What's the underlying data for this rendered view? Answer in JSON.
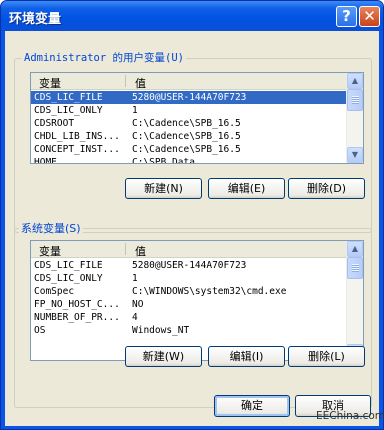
{
  "window": {
    "title": "环境变量",
    "help_label": "?",
    "close_label": "✕"
  },
  "user_vars": {
    "group_label": "Administrator 的用户变量(U)",
    "columns": [
      "变量",
      "值"
    ],
    "rows": [
      {
        "name": "CDS_LIC_FILE",
        "value": "5280@USER-144A70F723",
        "selected": true
      },
      {
        "name": "CDS_LIC_ONLY",
        "value": "1"
      },
      {
        "name": "CDSROOT",
        "value": "C:\\Cadence\\SPB_16.5"
      },
      {
        "name": "CHDL_LIB_INS...",
        "value": "C:\\Cadence\\SPB_16.5"
      },
      {
        "name": "CONCEPT_INST...",
        "value": "C:\\Cadence\\SPB_16.5"
      },
      {
        "name": "HOME",
        "value": "C:\\SPB_Data"
      }
    ],
    "buttons": {
      "new": "新建(N)",
      "edit": "编辑(E)",
      "delete": "删除(D)"
    }
  },
  "system_vars": {
    "group_label": "系统变量(S)",
    "columns": [
      "变量",
      "值"
    ],
    "rows": [
      {
        "name": "CDS_LIC_FILE",
        "value": "5280@USER-144A70F723"
      },
      {
        "name": "CDS_LIC_ONLY",
        "value": "1"
      },
      {
        "name": "ComSpec",
        "value": "C:\\WINDOWS\\system32\\cmd.exe"
      },
      {
        "name": "FP_NO_HOST_C...",
        "value": "NO"
      },
      {
        "name": "NUMBER_OF_PR...",
        "value": "4"
      },
      {
        "name": "OS",
        "value": "Windows_NT"
      }
    ],
    "buttons": {
      "new": "新建(W)",
      "edit": "编辑(I)",
      "delete": "删除(L)"
    }
  },
  "footer": {
    "ok": "确定",
    "cancel": "取消"
  },
  "watermark": "EEChina.com",
  "icons": {
    "scroll_up": "scroll-up-arrow-icon",
    "scroll_down": "scroll-down-arrow-icon"
  },
  "colors": {
    "titlebar": "#0055e5",
    "selection": "#316ac5",
    "group_label": "#0046d5",
    "dialog_bg": "#ece9d8"
  }
}
